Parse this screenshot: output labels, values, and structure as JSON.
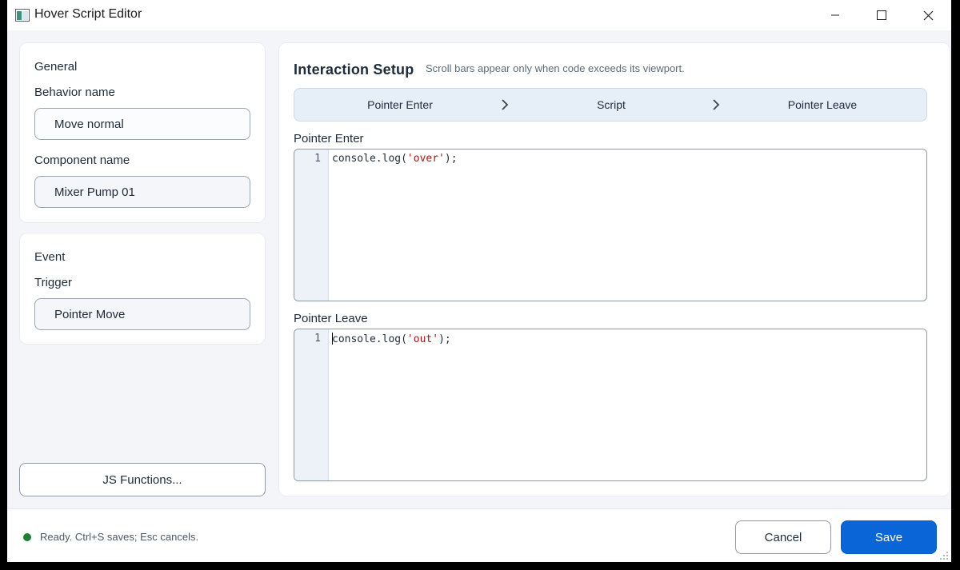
{
  "window": {
    "title": "Hover Script Editor",
    "icons": {
      "app": "app-window-icon",
      "minimize": "minimize-icon",
      "maximize": "maximize-icon",
      "close": "close-icon"
    }
  },
  "general": {
    "title": "General",
    "behavior_label": "Behavior name",
    "behavior_value": "Move normal",
    "component_label": "Component name",
    "component_value": "Mixer Pump 01"
  },
  "event": {
    "title": "Event",
    "trigger_label": "Trigger",
    "trigger_value": "Pointer Move"
  },
  "js_functions_label": "JS Functions...",
  "panel": {
    "title": "Interaction Setup",
    "hint": "Scroll bars appear only when code exceeds its viewport.",
    "steps": [
      {
        "label": "Pointer Enter"
      },
      {
        "label": "Script"
      },
      {
        "label": "Pointer Leave"
      }
    ],
    "enter_editor": {
      "label": "Pointer Enter",
      "line_number": "1",
      "code_before": "console.log(",
      "code_string": "'over'",
      "code_after": ");"
    },
    "leave_editor": {
      "label": "Pointer Leave",
      "line_number": "1",
      "code_before": "console.log(",
      "code_string": "'out'",
      "code_after": ");"
    }
  },
  "footer": {
    "status": "Ready. Ctrl+S saves; Esc cancels.",
    "status_color": "#1e7e34",
    "cancel_label": "Cancel",
    "save_label": "Save",
    "accent": "#0a66d6"
  }
}
